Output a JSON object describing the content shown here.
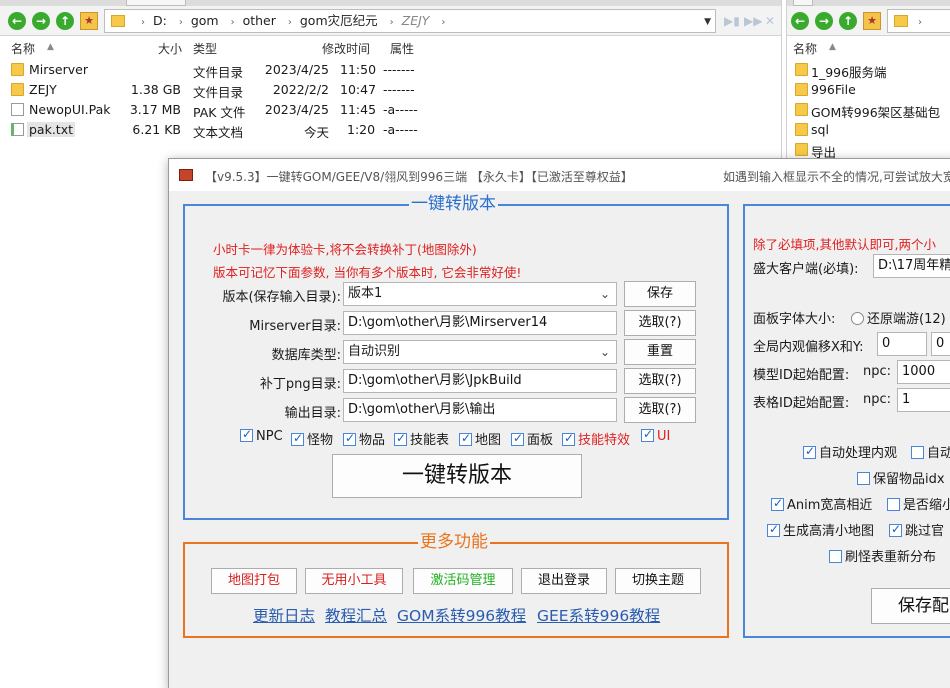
{
  "left_pane": {
    "address": {
      "crumbs": [
        "D:",
        "gom",
        "other",
        "gom灾厄纪元",
        "ZEJY"
      ]
    },
    "columns": {
      "name": "名称",
      "size": "大小",
      "type": "类型",
      "modified": "修改时间",
      "attr": "属性"
    },
    "files": [
      {
        "name": "Mirserver",
        "size": "",
        "type": "文件目录",
        "date": "2023/4/25",
        "time": "11:50",
        "attr": "-------",
        "icon": "folder-icon"
      },
      {
        "name": "ZEJY",
        "size": "1.38 GB",
        "type": "文件目录",
        "date": "2022/2/2",
        "time": "10:47",
        "attr": "-------",
        "icon": "folder-icon"
      },
      {
        "name": "NewopUI.Pak",
        "size": "3.17 MB",
        "type": "PAK 文件",
        "date": "2023/4/25",
        "time": "11:45",
        "attr": "-a-----",
        "icon": "file-icon"
      },
      {
        "name": "pak.txt",
        "size": "6.21 KB",
        "type": "文本文档",
        "date": "今天",
        "time": "1:20",
        "attr": "-a-----",
        "icon": "text-file-icon"
      }
    ]
  },
  "right_pane": {
    "column_name": "名称",
    "files": [
      "1_996服务端",
      "996File",
      "GOM转996架区基础包",
      "sql",
      "导出"
    ]
  },
  "dialog": {
    "title": "【v9.5.3】一键转GOM/GEE/V8/翎风到996三端 【永久卡】【已激活至尊权益】",
    "title_right": "如遇到输入框显示不全的情况,可尝试放大宽",
    "convert_group": {
      "title": "一键转版本",
      "note1": "小时卡一律为体验卡,将不会转换补丁(地图除外)",
      "note2": "版本可记忆下面参数, 当你有多个版本时, 它会非常好使!",
      "fields": {
        "version_label": "版本(保存输入目录):",
        "version_value": "版本1",
        "save_btn": "保存",
        "mirserver_label": "Mirserver目录:",
        "mirserver_value": "D:\\gom\\other\\月影\\Mirserver14",
        "pick1": "选取(?)",
        "db_label": "数据库类型:",
        "db_value": "自动识别",
        "reset_btn": "重置",
        "patch_label": "补丁png目录:",
        "patch_value": "D:\\gom\\other\\月影\\JpkBuild",
        "pick2": "选取(?)",
        "output_label": "输出目录:",
        "output_value": "D:\\gom\\other\\月影\\输出",
        "pick3": "选取(?)"
      },
      "checks": [
        {
          "label": "NPC",
          "red": false
        },
        {
          "label": "怪物",
          "red": false
        },
        {
          "label": "物品",
          "red": false
        },
        {
          "label": "技能表",
          "red": false
        },
        {
          "label": "地图",
          "red": false
        },
        {
          "label": "面板",
          "red": false
        },
        {
          "label": "技能特效",
          "red": true
        },
        {
          "label": "UI",
          "red": true
        }
      ],
      "convert_btn": "一键转版本"
    },
    "more_group": {
      "title": "更多功能",
      "buttons": [
        "地图打包",
        "无用小工具",
        "激活码管理",
        "退出登录",
        "切换主题"
      ],
      "links": [
        "更新日志",
        "教程汇总",
        "GOM系转996教程",
        "GEE系转996教程"
      ]
    },
    "right_group": {
      "note": "除了必填项,其他默认即可,两个小",
      "client_label": "盛大客户端(必填):",
      "client_value": "D:\\17周年精",
      "font_label": "面板字体大小:",
      "font_option": "还原端游(12)",
      "offset_label": "全局内观偏移X和Y:",
      "offset_x": "0",
      "offset_y": "0",
      "model_label": "模型ID起始配置:",
      "model_prefix": "npc:",
      "model_value": "1000",
      "table_label": "表格ID起始配置:",
      "table_prefix": "npc:",
      "table_value": "1",
      "opt1": "自动处理内观",
      "opt1b": "自动",
      "opt2": "保留物品idx",
      "opt3": "Anim宽高相近",
      "opt3b": "是否缩小",
      "opt4": "生成高清小地图",
      "opt4b": "跳过官",
      "opt5": "刷怪表重新分布",
      "save_btn": "保存配"
    }
  }
}
